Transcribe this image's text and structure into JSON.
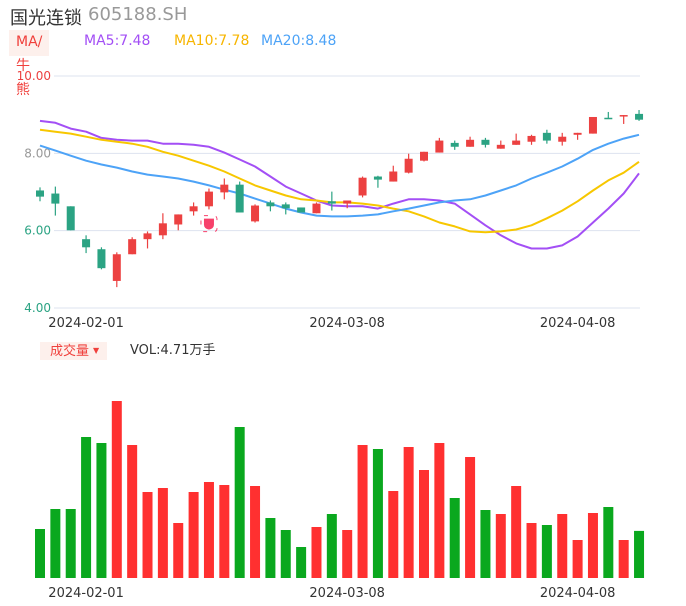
{
  "header": {
    "name": "国光连锁",
    "code": "605188.SH"
  },
  "indicators": {
    "tag": "MA/牛熊",
    "ma5": "MA5:7.48",
    "ma10": "MA10:7.78",
    "ma20": "MA20:8.48"
  },
  "volume_header": {
    "tag": "成交量",
    "value": "VOL:4.71万手"
  },
  "colors": {
    "up": "#ec4141",
    "down": "#2ba383",
    "ma5": "#a34ff5",
    "ma10": "#f7c700",
    "ma20": "#4da3f7",
    "vol_up": "#ff3030",
    "vol_down": "#0aa81e",
    "grid": "#dde3ef"
  },
  "chart_data": [
    {
      "type": "candlestick",
      "title": "国光连锁 605188.SH",
      "ylim": [
        4,
        10
      ],
      "y_ticks": [
        {
          "value": 10,
          "label": "10.00",
          "color": "#ec4141"
        },
        {
          "value": 8,
          "label": "8.00",
          "color": "#999999"
        },
        {
          "value": 6,
          "label": "6.00",
          "color": "#2ba383"
        },
        {
          "value": 4,
          "label": "4.00",
          "color": "#2ba383"
        }
      ],
      "x_ticks": [
        {
          "index": 3,
          "label": "2024-02-01"
        },
        {
          "index": 20,
          "label": "2024-03-08"
        },
        {
          "index": 35,
          "label": "2024-04-08"
        }
      ],
      "ohlc": [
        [
          7.04,
          7.12,
          6.76,
          6.88
        ],
        [
          6.96,
          7.14,
          6.39,
          6.7
        ],
        [
          6.63,
          6.63,
          6.01,
          6.01
        ],
        [
          5.78,
          5.88,
          5.42,
          5.57
        ],
        [
          5.52,
          5.57,
          5.0,
          5.03
        ],
        [
          4.7,
          5.44,
          4.54,
          5.39
        ],
        [
          5.39,
          5.83,
          5.39,
          5.78
        ],
        [
          5.78,
          5.98,
          5.54,
          5.93
        ],
        [
          5.88,
          6.45,
          5.78,
          6.19
        ],
        [
          6.16,
          6.42,
          6.01,
          6.42
        ],
        [
          6.5,
          6.73,
          6.39,
          6.63
        ],
        [
          6.63,
          7.09,
          6.55,
          7.01
        ],
        [
          6.99,
          7.35,
          6.81,
          7.19
        ],
        [
          7.19,
          7.27,
          6.47,
          6.47
        ],
        [
          6.24,
          6.68,
          6.21,
          6.65
        ],
        [
          6.73,
          6.78,
          6.5,
          6.63
        ],
        [
          6.68,
          6.73,
          6.42,
          6.58
        ],
        [
          6.6,
          6.6,
          6.47,
          6.47
        ],
        [
          6.45,
          6.73,
          6.45,
          6.7
        ],
        [
          6.76,
          7.01,
          6.52,
          6.7
        ],
        [
          6.7,
          6.78,
          6.58,
          6.78
        ],
        [
          6.91,
          7.4,
          6.86,
          7.37
        ],
        [
          7.4,
          7.42,
          7.11,
          7.32
        ],
        [
          7.27,
          7.68,
          7.27,
          7.53
        ],
        [
          7.5,
          7.99,
          7.48,
          7.86
        ],
        [
          7.81,
          8.04,
          7.79,
          8.04
        ],
        [
          8.02,
          8.4,
          8.02,
          8.33
        ],
        [
          8.27,
          8.33,
          8.09,
          8.17
        ],
        [
          8.17,
          8.43,
          8.17,
          8.35
        ],
        [
          8.35,
          8.4,
          8.15,
          8.22
        ],
        [
          8.12,
          8.33,
          8.12,
          8.22
        ],
        [
          8.22,
          8.51,
          8.22,
          8.33
        ],
        [
          8.3,
          8.48,
          8.22,
          8.45
        ],
        [
          8.53,
          8.61,
          8.25,
          8.33
        ],
        [
          8.3,
          8.53,
          8.2,
          8.43
        ],
        [
          8.48,
          8.53,
          8.35,
          8.53
        ],
        [
          8.51,
          8.94,
          8.51,
          8.94
        ],
        [
          8.92,
          9.07,
          8.89,
          8.89
        ],
        [
          8.97,
          8.99,
          8.76,
          8.99
        ],
        [
          9.02,
          9.12,
          8.84,
          8.87
        ]
      ],
      "series": [
        {
          "name": "MA5",
          "values": [
            8.84,
            8.79,
            8.64,
            8.56,
            8.4,
            8.35,
            8.33,
            8.33,
            8.25,
            8.25,
            8.22,
            8.17,
            8.02,
            7.84,
            7.66,
            7.4,
            7.14,
            6.96,
            6.78,
            6.65,
            6.63,
            6.63,
            6.57,
            6.7,
            6.81,
            6.81,
            6.78,
            6.7,
            6.42,
            6.14,
            5.88,
            5.67,
            5.54,
            5.54,
            5.62,
            5.85,
            6.21,
            6.57,
            6.96,
            7.48
          ]
        },
        {
          "name": "MA10",
          "values": [
            8.61,
            8.56,
            8.51,
            8.43,
            8.35,
            8.3,
            8.25,
            8.17,
            8.04,
            7.94,
            7.81,
            7.68,
            7.53,
            7.35,
            7.17,
            7.04,
            6.91,
            6.81,
            6.78,
            6.73,
            6.73,
            6.7,
            6.65,
            6.57,
            6.5,
            6.37,
            6.21,
            6.11,
            5.98,
            5.96,
            5.98,
            6.03,
            6.14,
            6.32,
            6.52,
            6.76,
            7.04,
            7.3,
            7.5,
            7.78
          ]
        },
        {
          "name": "MA20",
          "values": [
            8.2,
            8.07,
            7.94,
            7.81,
            7.71,
            7.63,
            7.53,
            7.45,
            7.4,
            7.35,
            7.27,
            7.17,
            7.06,
            6.96,
            6.83,
            6.7,
            6.57,
            6.47,
            6.39,
            6.37,
            6.37,
            6.39,
            6.42,
            6.5,
            6.57,
            6.65,
            6.73,
            6.78,
            6.81,
            6.91,
            7.04,
            7.17,
            7.35,
            7.5,
            7.66,
            7.86,
            8.09,
            8.25,
            8.38,
            8.48
          ]
        }
      ]
    },
    {
      "type": "bar",
      "title": "成交量",
      "unit": "万手",
      "x_ticks": [
        {
          "index": 3,
          "label": "2024-02-01"
        },
        {
          "index": 20,
          "label": "2024-03-08"
        },
        {
          "index": 35,
          "label": "2024-04-08"
        }
      ],
      "values": [
        4.9,
        6.9,
        6.9,
        14.1,
        13.5,
        17.7,
        13.3,
        8.6,
        9.0,
        5.5,
        8.6,
        9.6,
        9.3,
        15.1,
        9.2,
        6.0,
        4.8,
        3.1,
        5.1,
        6.4,
        4.8,
        13.3,
        12.9,
        8.7,
        13.1,
        10.8,
        13.5,
        8.0,
        12.1,
        6.8,
        6.4,
        9.2,
        5.5,
        5.3,
        6.4,
        3.8,
        6.5,
        7.1,
        3.8,
        4.71
      ]
    }
  ]
}
